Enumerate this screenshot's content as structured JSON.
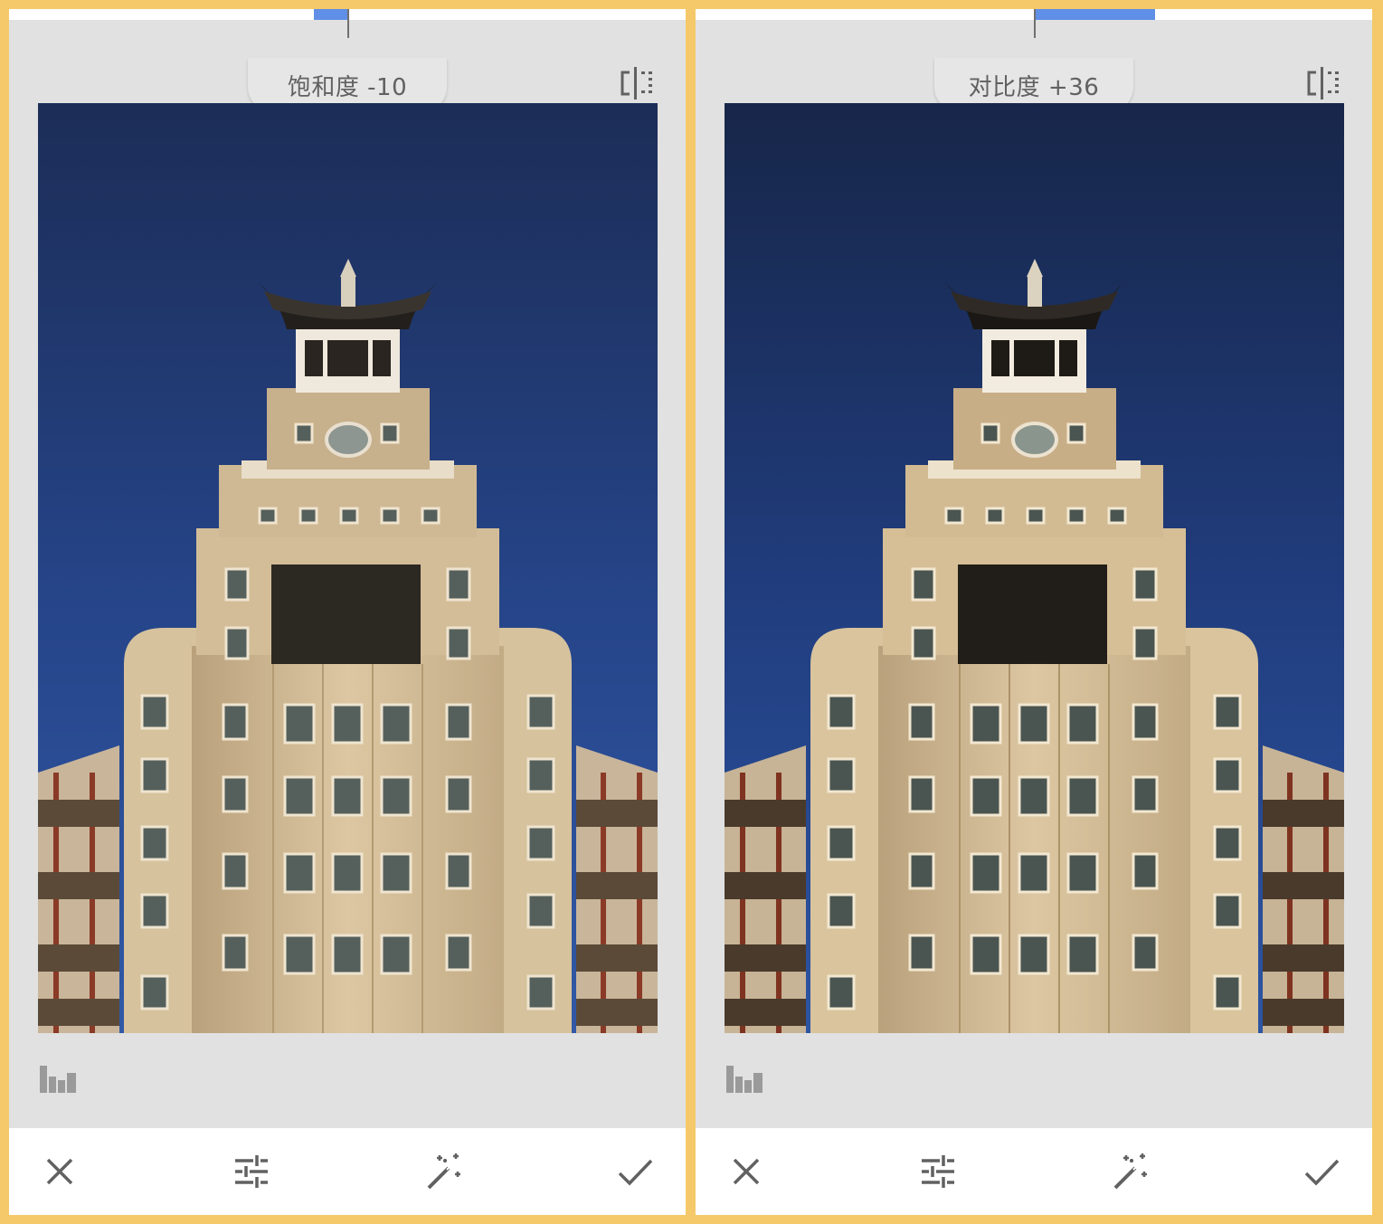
{
  "colors": {
    "frame": "#f5c96a",
    "slider_fill": "#5f8fe6",
    "background": "#e1e1e1",
    "icon": "#616161"
  },
  "panels": [
    {
      "adjustment_label": "饱和度 -10",
      "slider_value": -10,
      "icons": [
        "compare-icon",
        "histogram-icon",
        "close-icon",
        "tune-icon",
        "magic-wand-icon",
        "check-icon"
      ]
    },
    {
      "adjustment_label": "对比度 +36",
      "slider_value": 36,
      "icons": [
        "compare-icon",
        "histogram-icon",
        "close-icon",
        "tune-icon",
        "magic-wand-icon",
        "check-icon"
      ]
    }
  ]
}
